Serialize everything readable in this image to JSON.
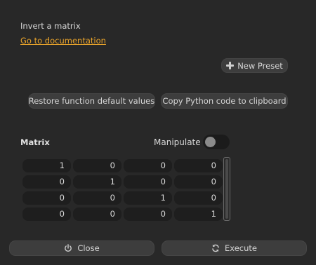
{
  "description": "Invert a matrix",
  "doc_link": "Go to documentation",
  "toolbar": {
    "new_preset_label": "New Preset",
    "restore_label": "Restore function default values",
    "copy_label": "Copy Python code to clipboard"
  },
  "matrix": {
    "label": "Matrix",
    "manipulate_label": "Manipulate",
    "manipulate_on": false,
    "rows": [
      [
        "1",
        "0",
        "0",
        "0"
      ],
      [
        "0",
        "1",
        "0",
        "0"
      ],
      [
        "0",
        "0",
        "1",
        "0"
      ],
      [
        "0",
        "0",
        "0",
        "1"
      ]
    ]
  },
  "footer": {
    "close_label": "Close",
    "execute_label": "Execute"
  },
  "icons": {
    "new_preset": "plus-icon",
    "close": "power-icon",
    "execute": "refresh-icon"
  },
  "colors": {
    "background": "#282828",
    "link": "#e8a32b",
    "button": "#3d3d3d",
    "cell": "#1e1e1e"
  }
}
